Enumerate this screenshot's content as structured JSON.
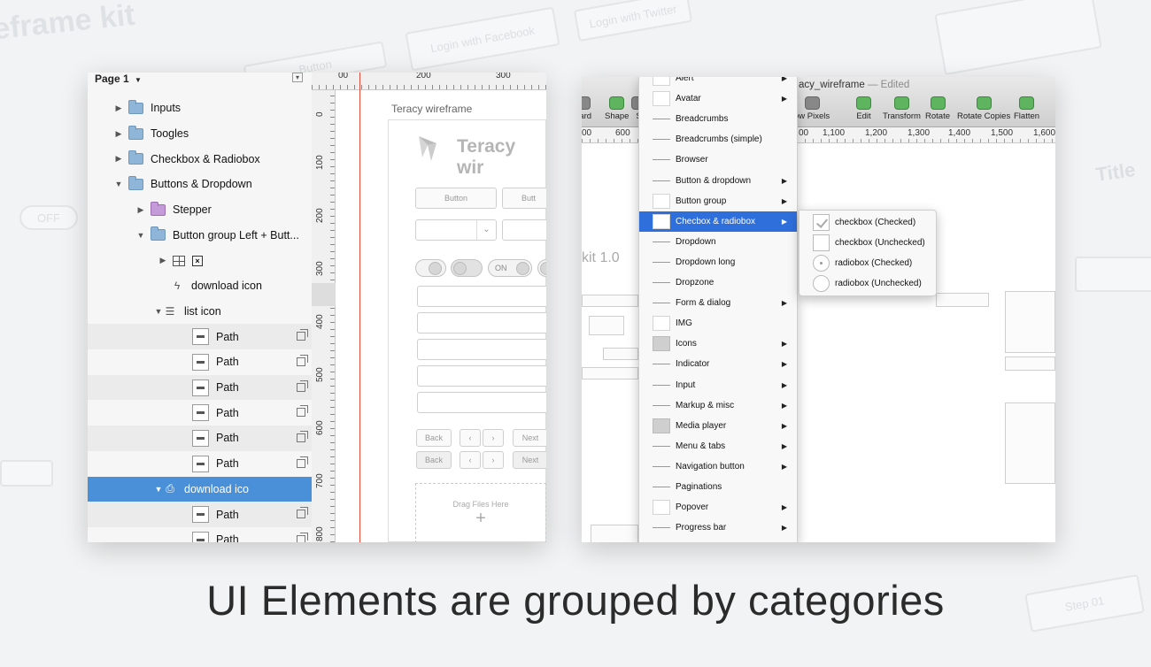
{
  "background": {
    "ghost_title": "eframe kit",
    "ghost_login_facebook": "Login with Facebook",
    "ghost_login_twitter": "Login with Twitter",
    "ghost_button": "Button",
    "ghost_toggle": "OFF",
    "ghost_title_right": "Title",
    "ghost_step": "Step 01"
  },
  "left_panel": {
    "page_label": "Page 1",
    "page_dropdown_icon": "triangle-down-icon",
    "tree": [
      {
        "label": "Inputs",
        "icon": "folder-icon",
        "expanded": false
      },
      {
        "label": "Toogles",
        "icon": "folder-icon",
        "expanded": false
      },
      {
        "label": "Checkbox & Radiobox",
        "icon": "folder-icon",
        "expanded": false
      },
      {
        "label": "Buttons & Dropdown",
        "icon": "folder-icon",
        "expanded": true
      },
      {
        "label": "Stepper",
        "icon": "folder-purple-icon",
        "expanded": false
      },
      {
        "label": "Button group Left + Butt...",
        "icon": "folder-icon",
        "expanded": true
      },
      {
        "label": "",
        "icon": "grid-icon",
        "expanded": false
      },
      {
        "label": "download icon",
        "icon": "lightning-icon"
      },
      {
        "label": "list icon",
        "icon": "list-icon",
        "expanded": true
      },
      {
        "label": "Path",
        "icon": "shape-icon"
      },
      {
        "label": "Path",
        "icon": "shape-icon"
      },
      {
        "label": "Path",
        "icon": "shape-icon"
      },
      {
        "label": "Path",
        "icon": "shape-icon"
      },
      {
        "label": "Path",
        "icon": "shape-icon"
      },
      {
        "label": "Path",
        "icon": "shape-icon"
      },
      {
        "label": "download ico",
        "icon": "download-icon",
        "expanded": true,
        "selected": true
      },
      {
        "label": "Path",
        "icon": "shape-icon"
      },
      {
        "label": "Path",
        "icon": "shape-icon"
      }
    ],
    "ruler_top": [
      "00",
      "200",
      "300"
    ],
    "ruler_left": [
      "0",
      "100",
      "200",
      "300",
      "400",
      "500",
      "600",
      "700",
      "800"
    ],
    "canvas_title": "Teracy wireframe",
    "logo_text": "Teracy wir",
    "btn_label": "Button",
    "btn_label_cut": "Butt",
    "toggle_on": "ON",
    "back_label": "Back",
    "next_label": "Next",
    "drop_label": "Drag Files Here"
  },
  "right_panel": {
    "window_title": "acy_wireframe",
    "window_edited": "— Edited",
    "tools": [
      {
        "label": "oard",
        "icon": "clipboard-icon"
      },
      {
        "label": "Shape",
        "icon": "shape-tool-icon"
      },
      {
        "label": "S",
        "icon": "symbol-icon"
      },
      {
        "label": "ow Pixels",
        "icon": "pixels-icon"
      },
      {
        "label": "Edit",
        "icon": "edit-icon"
      },
      {
        "label": "Transform",
        "icon": "transform-icon"
      },
      {
        "label": "Rotate",
        "icon": "rotate-icon"
      },
      {
        "label": "Rotate Copies",
        "icon": "rotate-copies-icon"
      },
      {
        "label": "Flatten",
        "icon": "flatten-icon"
      }
    ],
    "ruler": [
      "00",
      "600",
      "00",
      "1,100",
      "1,200",
      "1,300",
      "1,400",
      "1,500",
      "1,600"
    ],
    "kit_title": "kit 1.0",
    "menu": [
      {
        "label": "Alert",
        "submenu": true,
        "thumb": "box"
      },
      {
        "label": "Avatar",
        "submenu": true,
        "thumb": "box"
      },
      {
        "label": "Breadcrumbs",
        "submenu": false,
        "thumb": "line"
      },
      {
        "label": "Breadcrumbs (simple)",
        "submenu": false,
        "thumb": "line"
      },
      {
        "label": "Browser",
        "submenu": false,
        "thumb": "line"
      },
      {
        "label": "Button & dropdown",
        "submenu": true,
        "thumb": "line"
      },
      {
        "label": "Button group",
        "submenu": true,
        "thumb": "box"
      },
      {
        "label": "Checbox & radiobox",
        "submenu": true,
        "thumb": "box",
        "active": true
      },
      {
        "label": "Dropdown",
        "submenu": false,
        "thumb": "line"
      },
      {
        "label": "Dropdown long",
        "submenu": false,
        "thumb": "line"
      },
      {
        "label": "Dropzone",
        "submenu": false,
        "thumb": "line"
      },
      {
        "label": "Form & dialog",
        "submenu": true,
        "thumb": "line"
      },
      {
        "label": "IMG",
        "submenu": false,
        "thumb": "box"
      },
      {
        "label": "Icons",
        "submenu": true,
        "thumb": "solid"
      },
      {
        "label": "Indicator",
        "submenu": true,
        "thumb": "line"
      },
      {
        "label": "Input",
        "submenu": true,
        "thumb": "line"
      },
      {
        "label": "Markup & misc",
        "submenu": true,
        "thumb": "line"
      },
      {
        "label": "Media player",
        "submenu": true,
        "thumb": "solid"
      },
      {
        "label": "Menu & tabs",
        "submenu": true,
        "thumb": "line"
      },
      {
        "label": "Navigation button",
        "submenu": true,
        "thumb": "line"
      },
      {
        "label": "Paginations",
        "submenu": false,
        "thumb": "line"
      },
      {
        "label": "Popover",
        "submenu": true,
        "thumb": "box"
      },
      {
        "label": "Progress bar",
        "submenu": true,
        "thumb": "line"
      }
    ],
    "submenu": [
      {
        "label": "checkbox (Checked)",
        "thumb": "checked"
      },
      {
        "label": "checkbox (Unchecked)",
        "thumb": "box"
      },
      {
        "label": "radiobox (Checked)",
        "thumb": "dot"
      },
      {
        "label": "radiobox (Unchecked)",
        "thumb": "round"
      }
    ]
  },
  "caption": "UI Elements are grouped by categories"
}
